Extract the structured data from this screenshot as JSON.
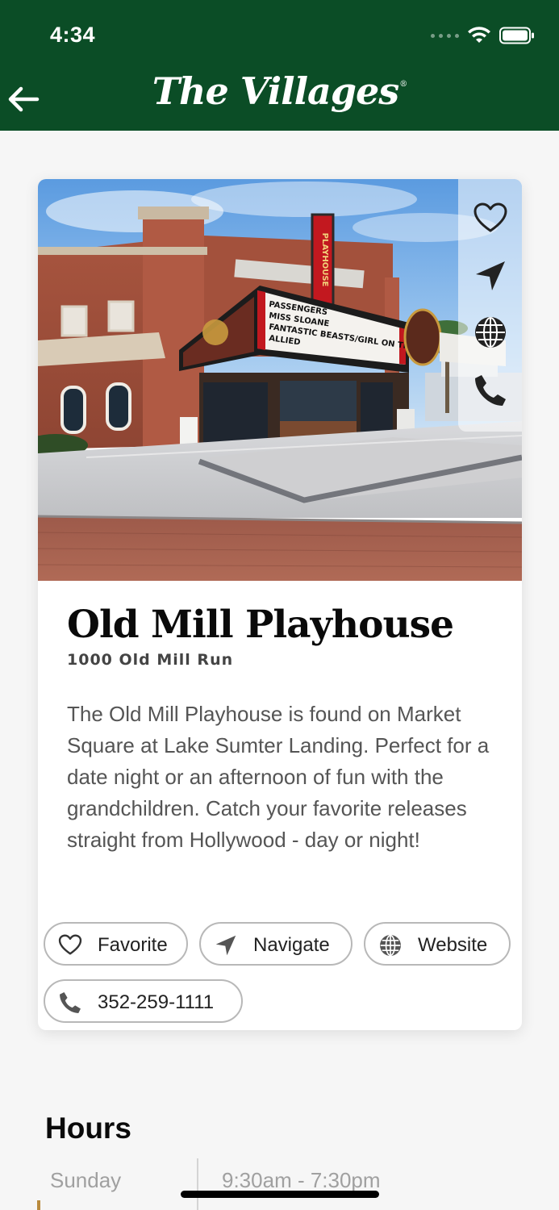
{
  "status_bar": {
    "time": "4:34"
  },
  "nav": {
    "back_label": "Back",
    "brand": "The Villages"
  },
  "place": {
    "title": "Old Mill Playhouse",
    "address": "1000 Old Mill Run",
    "description": "The Old Mill Playhouse is found on Market Square at Lake Sumter Landing. Perfect for a date night or an afternoon of fun with the grandchildren. Catch your favorite releases straight from Hollywood - day or night!",
    "photo": {
      "marquee_lines": [
        "PASSENGERS",
        "MISS SLOANE",
        "FANTASTIC BEASTS/GIRL ON THE TRAIN",
        "ALLIED"
      ],
      "sign_text": "PLAYHOUSE"
    }
  },
  "actions": {
    "favorite_label": "Favorite",
    "navigate_label": "Navigate",
    "website_label": "Website",
    "phone_label": "352-259-1111"
  },
  "hours": {
    "title": "Hours",
    "rows": [
      {
        "day": "Sunday",
        "time": "9:30am - 7:30pm"
      }
    ]
  },
  "icons": {
    "favorite": "heart-icon",
    "navigate": "location-arrow-icon",
    "website": "globe-icon",
    "phone": "phone-icon",
    "back": "arrow-left-icon"
  },
  "colors": {
    "brand_green": "#0b4d26",
    "accent_gold": "#b98a3d",
    "marquee_red": "#c2181f"
  }
}
